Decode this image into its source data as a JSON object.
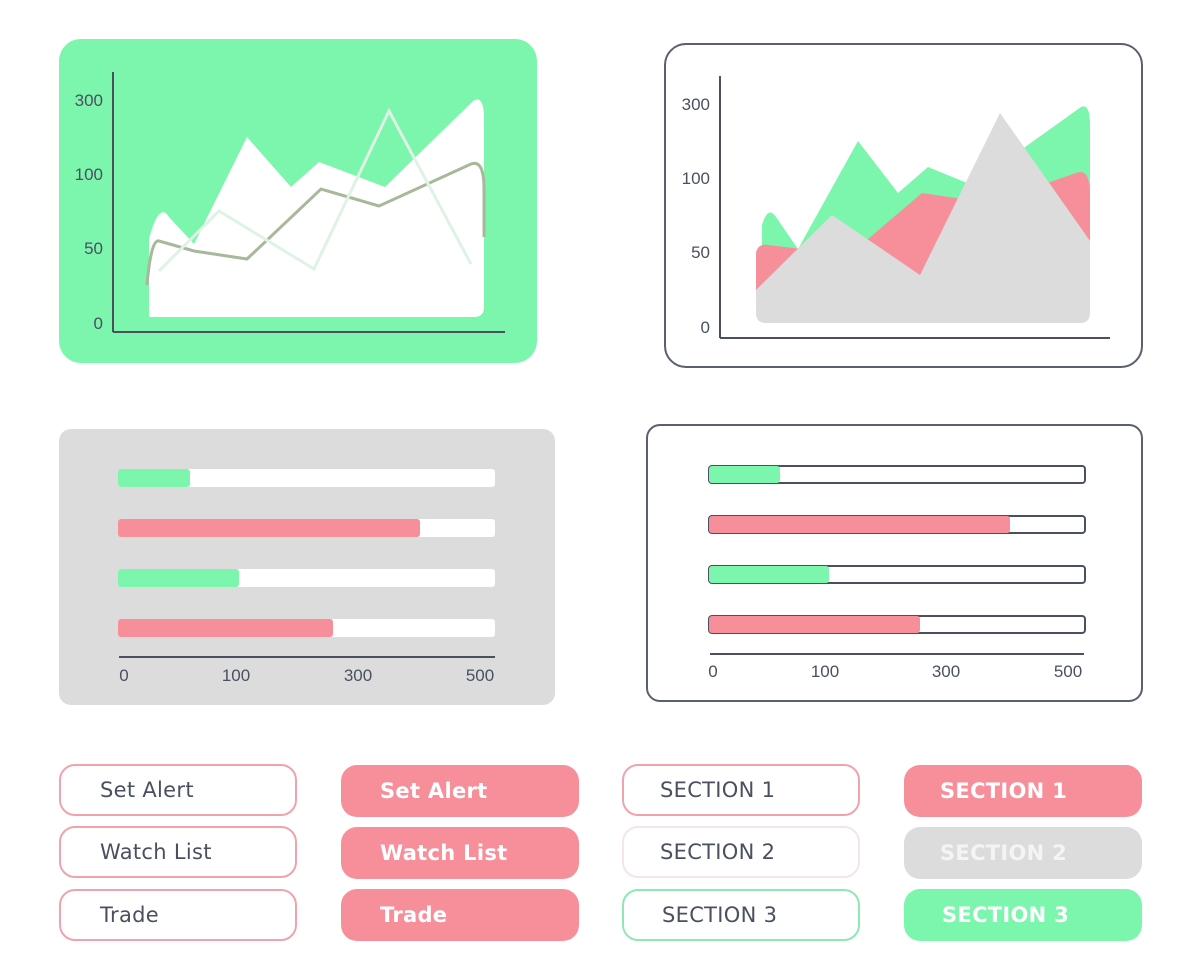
{
  "colors": {
    "green": "#7cf5ad",
    "red": "#f78f9b",
    "grey": "#dcdcdc",
    "axis": "#4a5060",
    "white": "#ffffff"
  },
  "chart_data": [
    {
      "type": "area",
      "y_tick_labels": [
        "0",
        "50",
        "100",
        "300"
      ],
      "grid": false,
      "series": [
        {
          "color": "#ffffff",
          "values": [
            40,
            85,
            55,
            160,
            120,
            135,
            130,
            225
          ]
        },
        {
          "color": "#b0c8a0",
          "values": [
            85,
            70,
            125,
            110,
            135
          ]
        },
        {
          "color": "#e8f5ec",
          "values": [
            75,
            70,
            50,
            215,
            90
          ]
        }
      ]
    },
    {
      "type": "area",
      "y_tick_labels": [
        "0",
        "50",
        "100",
        "300"
      ],
      "grid": false,
      "series": [
        {
          "color": "#7cf5ad",
          "values": [
            45,
            100,
            170,
            130,
            140,
            220
          ]
        },
        {
          "color": "#f78f9b",
          "values": [
            70,
            80,
            130,
            125,
            140
          ]
        },
        {
          "color": "#dcdcdc",
          "values": [
            30,
            110,
            50,
            210,
            80
          ]
        }
      ]
    },
    {
      "type": "bar",
      "orientation": "horizontal",
      "x_tick_labels": [
        "0",
        "100",
        "300",
        "500"
      ],
      "values": [
        0.19,
        0.8,
        0.32,
        0.57
      ],
      "colors": [
        "#7cf5ad",
        "#f78f9b",
        "#7cf5ad",
        "#f78f9b"
      ]
    },
    {
      "type": "bar",
      "orientation": "horizontal",
      "x_tick_labels": [
        "0",
        "100",
        "300",
        "500"
      ],
      "values": [
        0.19,
        0.8,
        0.32,
        0.56
      ],
      "colors": [
        "#7cf5ad",
        "#f78f9b",
        "#7cf5ad",
        "#f78f9b"
      ]
    }
  ],
  "buttons": {
    "set_alert": "Set Alert",
    "watch_list": "Watch List",
    "trade": "Trade",
    "section_1": "SECTION 1",
    "section_2": "SECTION 2",
    "section_3": "SECTION 3"
  }
}
